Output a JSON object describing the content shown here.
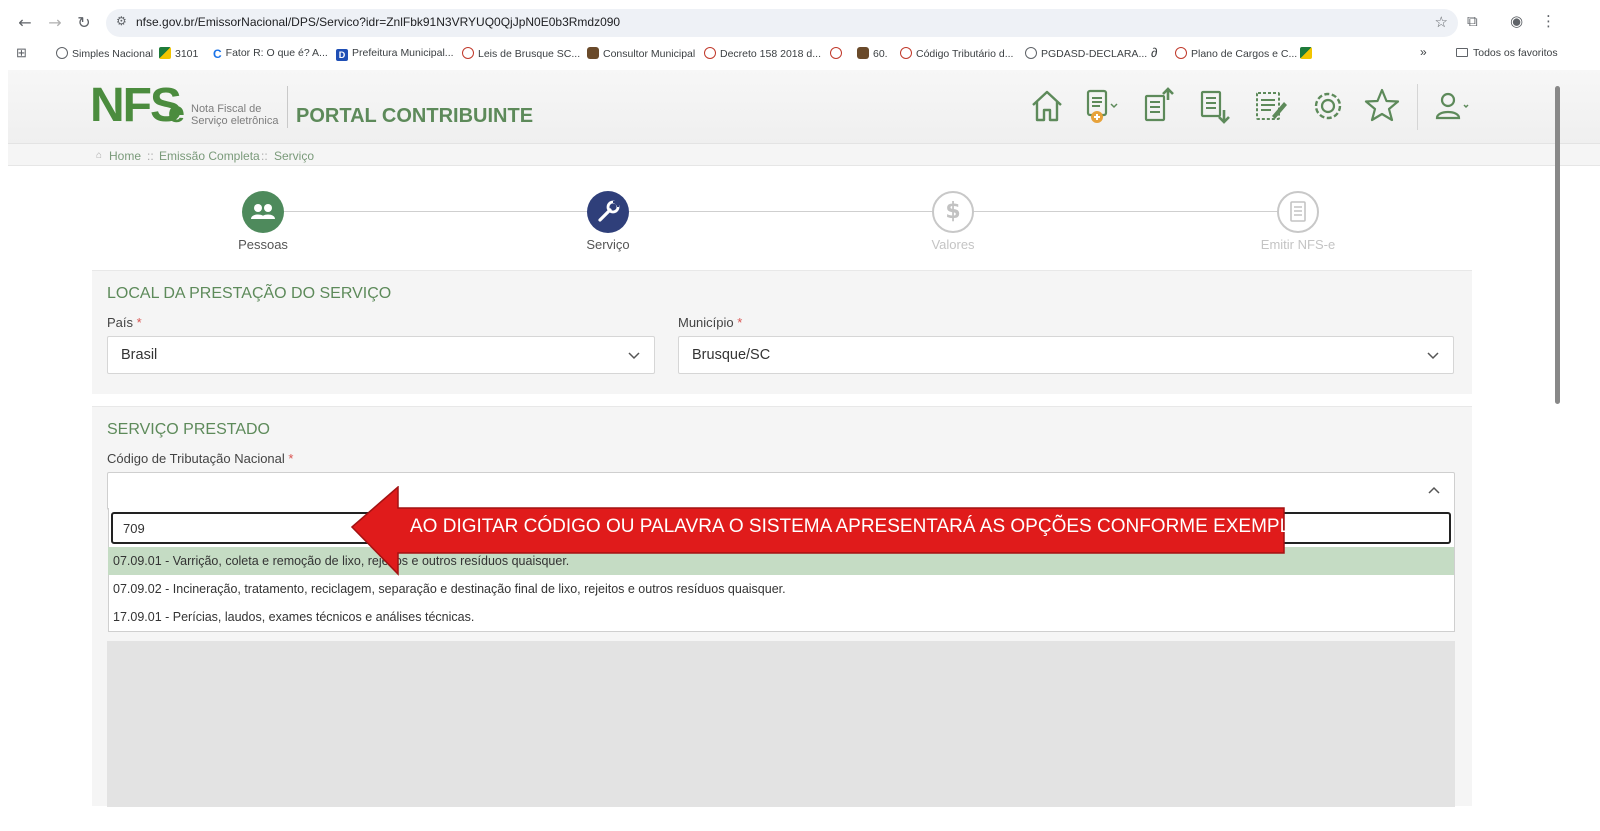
{
  "browser": {
    "url": "nfse.gov.br/EmissorNacional/DPS/Servico?idr=ZnlFbk91N3VRYUQ0QjJpN0E0b3Rmdz090",
    "bookmarks": [
      {
        "label": "Simples Nacional",
        "icon": "globe-icon"
      },
      {
        "label": "3101",
        "icon": "flag-icon"
      },
      {
        "label": "Fator R: O que é? A...",
        "icon": "c-icon"
      },
      {
        "label": "Prefeitura Municipal...",
        "icon": "d-icon"
      },
      {
        "label": "Leis de Brusque SC...",
        "icon": "seal-icon"
      },
      {
        "label": "Consultor Municipal",
        "icon": "person-icon"
      },
      {
        "label": "Decreto 158 2018 d...",
        "icon": "seal-icon"
      },
      {
        "label": "",
        "icon": "seal-icon"
      },
      {
        "label": "60.",
        "icon": "person-icon"
      },
      {
        "label": "Código Tributário d...",
        "icon": "seal-icon"
      },
      {
        "label": "PGDASD-DECLARA...",
        "icon": "globe-icon"
      },
      {
        "label": "",
        "icon": "a-icon"
      },
      {
        "label": "Plano de Cargos e C...",
        "icon": "seal-icon"
      },
      {
        "label": "",
        "icon": "flag-icon"
      }
    ],
    "overflow": "»",
    "favorites_label": "Todos os favoritos"
  },
  "header": {
    "logo_main": "NFS",
    "logo_e": "e",
    "logo_sub_line1": "Nota Fiscal de",
    "logo_sub_line2": "Serviço eletrônica",
    "portal_title": "PORTAL CONTRIBUINTE"
  },
  "breadcrumb": {
    "home": "Home",
    "sep": "::",
    "level1": "Emissão Completa",
    "level2": "Serviço"
  },
  "stepper": {
    "steps": [
      {
        "label": "Pessoas",
        "state": "done",
        "color": "#4e8a5c"
      },
      {
        "label": "Serviço",
        "state": "active",
        "color": "#2f3f7a"
      },
      {
        "label": "Valores",
        "state": "pending",
        "color": "#c8c8c8"
      },
      {
        "label": "Emitir NFS-e",
        "state": "pending",
        "color": "#c8c8c8"
      }
    ]
  },
  "local_section": {
    "title": "LOCAL DA PRESTAÇÃO DO SERVIÇO",
    "pais_label": "País",
    "pais_value": "Brasil",
    "municipio_label": "Município",
    "municipio_value": "Brusque/SC",
    "required_mark": "*"
  },
  "servico_section": {
    "title": "SERVIÇO PRESTADO",
    "codigo_label": "Código de Tributação Nacional",
    "required_mark": "*",
    "search_value": "709",
    "options": [
      "07.09.01 - Varrição, coleta e remoção de lixo, rejeitos e outros resíduos quaisquer.",
      "07.09.02 - Incineração, tratamento, reciclagem, separação e destinação final de lixo, rejeitos e outros resíduos quaisquer.",
      "17.09.01 - Perícias, laudos, exames técnicos e análises técnicas."
    ],
    "highlight_color": "#c5dcc4"
  },
  "annotation": {
    "text": "AO DIGITAR CÓDIGO OU PALAVRA O SISTEMA APRESENTARÁ AS OPÇÕES CONFORME EXEMPLO",
    "color": "#e01b1b"
  },
  "colors": {
    "brand_green": "#4b8c3e",
    "title_green": "#5d8a5a"
  }
}
